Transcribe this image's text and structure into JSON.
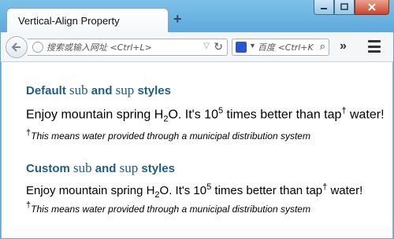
{
  "window": {
    "tab_title": "Vertical-Align Property",
    "tab_close": "×",
    "new_tab": "+",
    "minimize": "—",
    "maximize": "□",
    "close": "✕"
  },
  "navbar": {
    "url_placeholder": "搜索或输入网址 <Ctrl+L>",
    "search_placeholder": "百度 <Ctrl+K>",
    "engine_label": "🐾"
  },
  "content": {
    "section1": {
      "heading_pre": "Default ",
      "heading_sub": "sub",
      "heading_and": " and ",
      "heading_sup": "sup",
      "heading_post": " styles",
      "line_a": "Enjoy mountain spring H",
      "sub_text": "2",
      "line_b": "O. It's 10",
      "sup_text": "5",
      "line_c": " times better than tap",
      "dagger": "†",
      "line_d": " water!",
      "note": "This means water provided through a municipal distribution system"
    },
    "section2": {
      "heading_pre": "Custom ",
      "heading_sub": "sub",
      "heading_and": " and ",
      "heading_sup": "sup",
      "heading_post": " styles",
      "line_a": "Enjoy mountain spring H",
      "sub_text": "2",
      "line_b": "O. It's 10",
      "sup_text": "5",
      "line_c": " times better than tap",
      "dagger": "†",
      "line_d": " water!",
      "note": "This means water provided through a municipal distribution system"
    }
  }
}
